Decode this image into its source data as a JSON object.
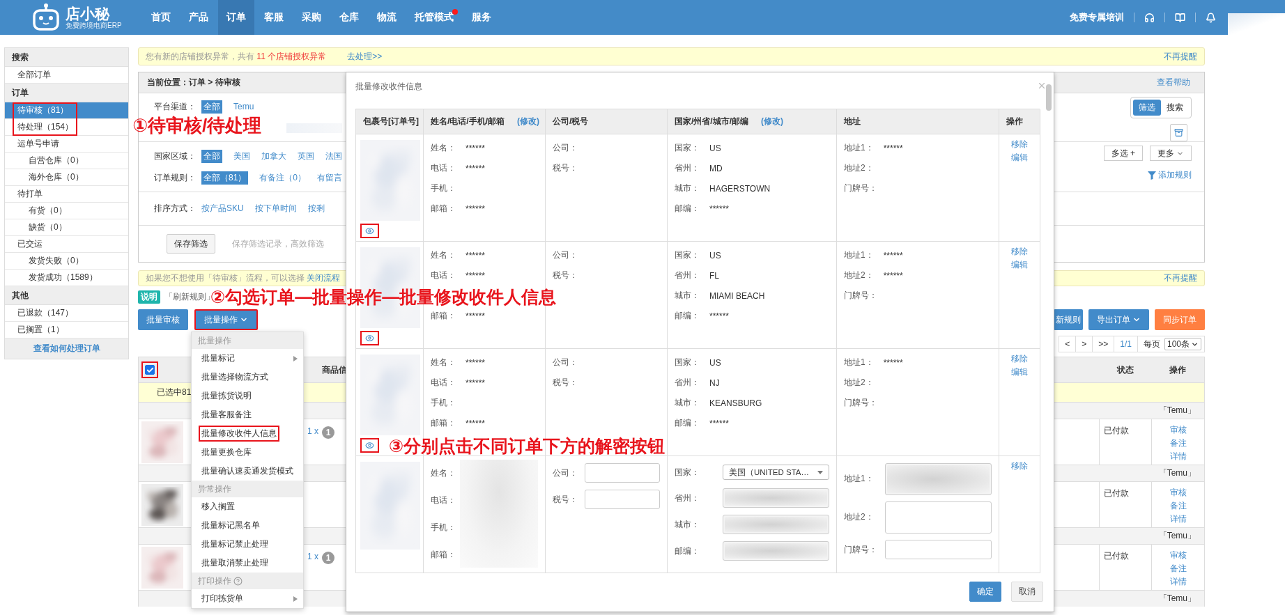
{
  "nav": {
    "logo_name": "店小秘",
    "logo_tagline": "免费跨境电商ERP",
    "items": [
      {
        "label": "首页",
        "selected": false,
        "dot": false
      },
      {
        "label": "产品",
        "selected": false,
        "dot": false
      },
      {
        "label": "订单",
        "selected": true,
        "dot": false
      },
      {
        "label": "客服",
        "selected": false,
        "dot": false
      },
      {
        "label": "采购",
        "selected": false,
        "dot": false
      },
      {
        "label": "仓库",
        "selected": false,
        "dot": false
      },
      {
        "label": "物流",
        "selected": false,
        "dot": false
      },
      {
        "label": "托管模式",
        "selected": false,
        "dot": true
      },
      {
        "label": "服务",
        "selected": false,
        "dot": false
      }
    ],
    "training": "免费专属培训"
  },
  "sidebar": {
    "sections": [
      {
        "title": "搜索",
        "items": [
          {
            "label": "全部订单",
            "selected": false,
            "highlighted": false
          }
        ]
      },
      {
        "title": "订单",
        "items": [
          {
            "label": "待审核（81）",
            "selected": true,
            "highlighted": true
          },
          {
            "label": "待处理（154）",
            "selected": false,
            "highlighted": true
          },
          {
            "label": "运单号申请",
            "selected": false,
            "highlighted": false,
            "children": [
              {
                "label": "自营仓库（0）",
                "selected": false,
                "highlighted": false
              },
              {
                "label": "海外仓库（0）",
                "selected": false,
                "highlighted": false
              }
            ]
          },
          {
            "label": "待打单",
            "selected": false,
            "highlighted": false,
            "children": [
              {
                "label": "有货（0）",
                "selected": false,
                "highlighted": false
              },
              {
                "label": "缺货（0）",
                "selected": false,
                "highlighted": false
              }
            ]
          },
          {
            "label": "已交运",
            "selected": false,
            "highlighted": false,
            "children": [
              {
                "label": "发货失败（0）",
                "selected": false,
                "highlighted": false
              },
              {
                "label": "发货成功（1589）",
                "selected": false,
                "highlighted": false
              }
            ]
          }
        ]
      },
      {
        "title": "其他",
        "items": [
          {
            "label": "已退款（147）",
            "selected": false,
            "highlighted": false
          },
          {
            "label": "已搁置（1）",
            "selected": false,
            "highlighted": false
          }
        ]
      }
    ],
    "help": "查看如何处理订单"
  },
  "notice": {
    "text": "您有新的店铺授权异常，共有 ",
    "count_text": "11 个店铺授权异常",
    "link": "去处理>>",
    "dismiss": "不再提醒"
  },
  "filter": {
    "location_label": "当前位置：",
    "location": "订单 > 待审核",
    "help": "查看帮助",
    "view_toggle": [
      {
        "label": "筛选",
        "selected": true
      },
      {
        "label": "搜索",
        "selected": false
      }
    ],
    "platform": {
      "label": "平台渠道：",
      "options": [
        {
          "label": "全部",
          "selected": true
        },
        {
          "label": "Temu",
          "selected": false
        }
      ]
    },
    "country": {
      "label": "国家区域：",
      "options": [
        {
          "label": "全部",
          "selected": true
        },
        {
          "label": "美国",
          "selected": false
        },
        {
          "label": "加拿大",
          "selected": false
        },
        {
          "label": "英国",
          "selected": false
        },
        {
          "label": "法国",
          "selected": false
        }
      ]
    },
    "multi": "多选 +",
    "more": "更多",
    "rules": {
      "label": "订单规则：",
      "options": [
        {
          "label": "全部（81）",
          "selected": true
        },
        {
          "label": "有备注（0）",
          "selected": false
        },
        {
          "label": "有留言",
          "selected": false
        }
      ]
    },
    "add_rule": "添加规则",
    "sort": {
      "label": "排序方式：",
      "options": [
        {
          "label": "按产品SKU",
          "selected": false
        },
        {
          "label": "按下单时间",
          "selected": false
        },
        {
          "label": "按剩",
          "selected": false
        }
      ]
    },
    "save": "保存筛选",
    "save_hint": "保存筛选记录，高效筛选"
  },
  "notice2": {
    "text": "如果您不想使用「待审核」流程，可以选择 ",
    "link": "关闭流程",
    "dismiss": "不再提醒"
  },
  "tip": {
    "badge": "说明",
    "text": "「刷新规则」"
  },
  "actions": {
    "left": [
      {
        "label": "批量审核",
        "kind": "primary",
        "dropdown": false,
        "highlighted": false
      },
      {
        "label": "批量操作",
        "kind": "primary",
        "dropdown": true,
        "highlighted": true
      }
    ],
    "right": [
      {
        "label": "新规则",
        "kind": "primary",
        "dropdown": false,
        "highlighted": false
      },
      {
        "label": "导出订单",
        "kind": "primary",
        "dropdown": true,
        "highlighted": false
      },
      {
        "label": "同步订单",
        "kind": "orange",
        "dropdown": false,
        "highlighted": false
      }
    ]
  },
  "pagination": {
    "buttons": [
      "<",
      ">",
      ">>"
    ],
    "page": "1/1",
    "per_page_label": "每页",
    "per_page": "100条"
  },
  "table": {
    "select_all": {
      "checked": true,
      "highlighted": true
    },
    "product_header": "商品信",
    "status_header": "状态",
    "action_header": "操作",
    "selected_info": "已选中81",
    "groups": [
      {
        "shop": "「Temu」",
        "qty": "1 x",
        "qty_badge": "1",
        "status": "已付款",
        "actions": [
          "审核",
          "备注",
          "详情"
        ]
      },
      {
        "shop": "「Temu」",
        "status": "已付款",
        "actions": [
          "审核",
          "备注",
          "详情"
        ]
      },
      {
        "shop": "「Temu」",
        "qty": "1 x",
        "qty_badge": "1",
        "status": "已付款",
        "actions": [
          "审核",
          "备注",
          "详情"
        ]
      },
      {
        "shop": "「Temu」"
      }
    ]
  },
  "menu": {
    "sections": [
      {
        "title": "批量操作",
        "help": false,
        "items": [
          {
            "label": "批量标记",
            "submenu": true,
            "highlighted": false
          },
          {
            "label": "批量选择物流方式",
            "submenu": false,
            "highlighted": false
          },
          {
            "label": "批量拣货说明",
            "submenu": false,
            "highlighted": false
          },
          {
            "label": "批量客服备注",
            "submenu": false,
            "highlighted": false
          },
          {
            "label": "批量修改收件人信息",
            "submenu": false,
            "highlighted": true
          },
          {
            "label": "批量更换仓库",
            "submenu": false,
            "highlighted": false
          },
          {
            "label": "批量确认速卖通发货模式",
            "submenu": false,
            "highlighted": false
          }
        ]
      },
      {
        "title": "异常操作",
        "help": false,
        "items": [
          {
            "label": "移入搁置",
            "submenu": false,
            "highlighted": false
          },
          {
            "label": "批量标记黑名单",
            "submenu": false,
            "highlighted": false
          },
          {
            "label": "批量标记禁止处理",
            "submenu": false,
            "highlighted": false
          },
          {
            "label": "批量取消禁止处理",
            "submenu": false,
            "highlighted": false
          }
        ]
      },
      {
        "title": "打印操作",
        "help": true,
        "items": [
          {
            "label": "打印拣货单",
            "submenu": true,
            "highlighted": false
          }
        ]
      }
    ]
  },
  "dialog": {
    "title": "批量修改收件信息",
    "columns": [
      {
        "label": "包裹号[订单号]"
      },
      {
        "label": "姓名/电话/手机/邮箱",
        "edit": "(修改)"
      },
      {
        "label": "公司/税号"
      },
      {
        "label": "国家/州省/城市/邮编",
        "edit": "(修改)"
      },
      {
        "label": "地址"
      },
      {
        "label": "操作"
      }
    ],
    "rows": [
      {
        "kind": "masked",
        "decrypt_icon": true,
        "decrypt_highlighted": true,
        "contact": {
          "name": {
            "label": "姓名：",
            "value": "******"
          },
          "phone": {
            "label": "电话：",
            "value": "******"
          },
          "mobile": {
            "label": "手机："
          },
          "email": {
            "label": "邮箱：",
            "value": "******"
          }
        },
        "company": [
          {
            "label": "公司："
          },
          {
            "label": "税号："
          }
        ],
        "region": [
          {
            "label": "国家：",
            "value": "US"
          },
          {
            "label": "省州：",
            "value": "MD"
          },
          {
            "label": "城市：",
            "value": "HAGERSTOWN"
          },
          {
            "label": "邮编：",
            "value": "******"
          }
        ],
        "address": [
          {
            "label": "地址1：",
            "value": "******"
          },
          {
            "label": "地址2："
          },
          {
            "label": "门牌号："
          }
        ],
        "actions": [
          "移除",
          "编辑"
        ]
      },
      {
        "kind": "masked",
        "decrypt_icon": true,
        "decrypt_highlighted": true,
        "contact": {
          "name": {
            "label": "姓名：",
            "value": "******"
          },
          "phone": {
            "label": "电话：",
            "value": "******"
          },
          "email": {
            "label": "邮箱：",
            "value": "******"
          }
        },
        "company": [
          {
            "label": "公司："
          },
          {
            "label": "税号："
          }
        ],
        "region": [
          {
            "label": "国家：",
            "value": "US"
          },
          {
            "label": "省州：",
            "value": "FL"
          },
          {
            "label": "城市：",
            "value": "MIAMI BEACH"
          },
          {
            "label": "邮编：",
            "value": "******"
          }
        ],
        "address": [
          {
            "label": "地址1：",
            "value": "******"
          },
          {
            "label": "地址2：",
            "value": "******"
          },
          {
            "label": "门牌号："
          }
        ],
        "actions": [
          "移除",
          "编辑"
        ]
      },
      {
        "kind": "masked",
        "decrypt_icon": true,
        "decrypt_highlighted": true,
        "contact": {
          "name": {
            "label": "姓名：",
            "value": "******"
          },
          "phone": {
            "label": "电话：",
            "value": "******"
          },
          "mobile": {
            "label": "手机："
          },
          "email": {
            "label": "邮箱：",
            "value": "******"
          }
        },
        "company": [
          {
            "label": "公司："
          },
          {
            "label": "税号："
          }
        ],
        "region": [
          {
            "label": "国家：",
            "value": "US"
          },
          {
            "label": "省州：",
            "value": "NJ"
          },
          {
            "label": "城市：",
            "value": "KEANSBURG"
          },
          {
            "label": "邮编：",
            "value": "******"
          }
        ],
        "address": [
          {
            "label": "地址1：",
            "value": "******"
          },
          {
            "label": "地址2："
          },
          {
            "label": "门牌号："
          }
        ],
        "actions": [
          "移除",
          "编辑"
        ]
      },
      {
        "kind": "editing",
        "contact": {
          "name": {
            "label": "姓名："
          },
          "phone": {
            "label": "电话："
          },
          "mobile": {
            "label": "手机："
          },
          "email": {
            "label": "邮箱："
          }
        },
        "company": [
          {
            "label": "公司：",
            "kind": "input",
            "blurred": false
          },
          {
            "label": "税号：",
            "kind": "input",
            "blurred": false
          }
        ],
        "region": [
          {
            "label": "国家：",
            "kind": "select",
            "value": "美国（UNITED STA…"
          },
          {
            "label": "省州：",
            "kind": "input",
            "blurred": true
          },
          {
            "label": "城市：",
            "kind": "input",
            "blurred": true
          },
          {
            "label": "邮编：",
            "kind": "input",
            "blurred": true
          }
        ],
        "address": [
          {
            "label": "地址1：",
            "kind": "textarea",
            "blurred": true
          },
          {
            "label": "地址2：",
            "kind": "textarea",
            "blurred": false
          },
          {
            "label": "门牌号：",
            "kind": "input",
            "blurred": false
          }
        ],
        "actions": [
          "移除"
        ]
      }
    ],
    "buttons": [
      {
        "label": "确定",
        "kind": "primary"
      },
      {
        "label": "取消",
        "kind": "default"
      }
    ]
  },
  "annotations": [
    {
      "text": "①待审核/待处理"
    },
    {
      "text": "②勾选订单—批量操作—批量修改收件人信息"
    },
    {
      "text": "③分别点击不同订单下方的解密按钮"
    }
  ]
}
